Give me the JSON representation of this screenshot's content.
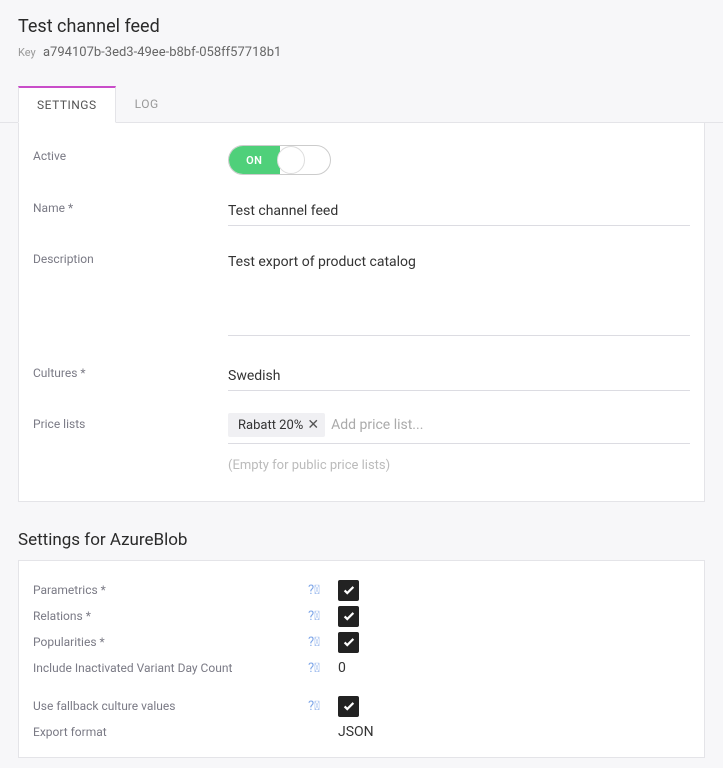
{
  "header": {
    "title": "Test channel feed",
    "key_label": "Key",
    "key_value": "a794107b-3ed3-49ee-b8bf-058ff57718b1"
  },
  "tabs": {
    "settings": "SETTINGS",
    "log": "LOG"
  },
  "form": {
    "active_label": "Active",
    "active_on": "ON",
    "name_label": "Name *",
    "name_value": "Test channel feed",
    "description_label": "Description",
    "description_value": "Test export of product catalog",
    "cultures_label": "Cultures *",
    "cultures_value": "Swedish",
    "price_lists_label": "Price lists",
    "price_lists_tag": "Rabatt 20%",
    "price_lists_placeholder": "Add price list...",
    "price_lists_hint": "(Empty for public price lists)"
  },
  "azure": {
    "section_title": "Settings for AzureBlob",
    "parametrics_label": "Parametrics *",
    "relations_label": "Relations *",
    "popularities_label": "Popularities *",
    "inactivated_label": "Include Inactivated Variant Day Count",
    "inactivated_value": "0",
    "fallback_label": "Use fallback culture values",
    "export_format_label": "Export format",
    "export_format_value": "JSON"
  }
}
